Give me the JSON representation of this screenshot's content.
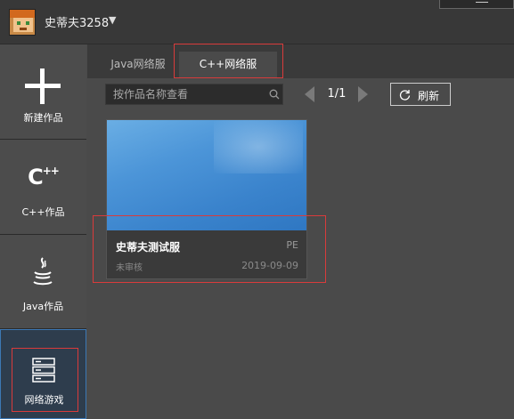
{
  "user": {
    "name": "史蒂夫3258",
    "menu_icon": "caret-down-icon"
  },
  "sidebar": {
    "items": [
      {
        "label": "新建作品",
        "icon": "plus-icon"
      },
      {
        "label": "C++作品",
        "icon": "cpp-icon",
        "icon_text": "C",
        "icon_sup": "++"
      },
      {
        "label": "Java作品",
        "icon": "java-icon"
      },
      {
        "label": "网络游戏",
        "icon": "server-icon",
        "selected": true
      }
    ]
  },
  "tabs": [
    {
      "label": "Java网络服",
      "active": false
    },
    {
      "label": "C++网络服",
      "active": true
    }
  ],
  "toolbar": {
    "search_placeholder": "按作品名称查看",
    "page": "1/1",
    "refresh_label": "刷新"
  },
  "cards": [
    {
      "name": "史蒂夫测试服",
      "type": "PE",
      "status": "未审核",
      "date": "2019-09-09"
    }
  ],
  "colors": {
    "highlight": "#d93b3b",
    "selected_border": "#3c78b4"
  }
}
